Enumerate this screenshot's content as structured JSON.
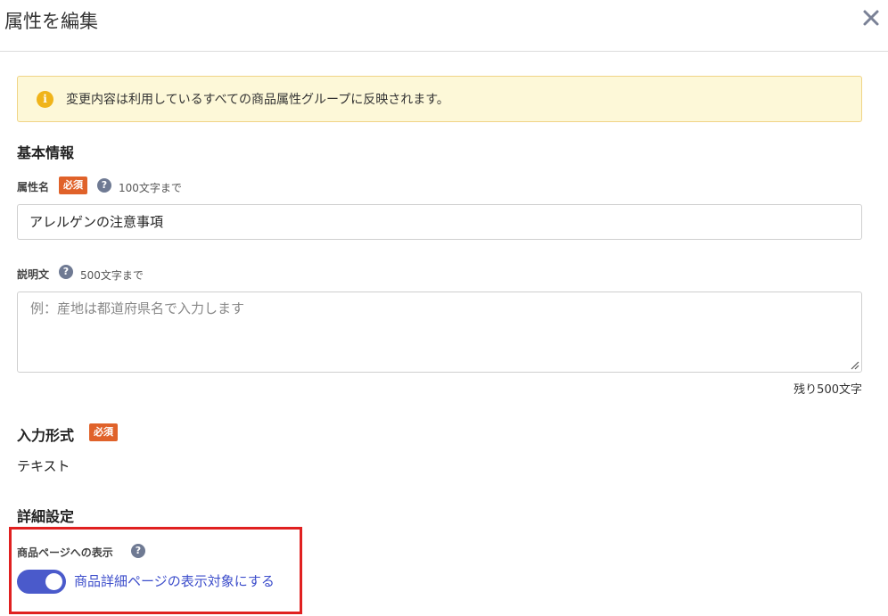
{
  "dialog": {
    "title": "属性を編集",
    "close_icon": "close-icon"
  },
  "notice": {
    "icon": "info-icon",
    "icon_glyph": "i",
    "text": "変更内容は利用しているすべての商品属性グループに反映されます。",
    "colors": {
      "background": "#fdf8d8",
      "border": "#f0d486",
      "icon": "#f0b41a"
    }
  },
  "basic_info": {
    "section_title": "基本情報",
    "attribute_name": {
      "label": "属性名",
      "required_badge": "必須",
      "help_glyph": "?",
      "hint": "100文字まで",
      "value": "アレルゲンの注意事項"
    },
    "description": {
      "label": "説明文",
      "help_glyph": "?",
      "hint": "500文字まで",
      "placeholder": "例：産地は都道府県名で入力します",
      "value": "",
      "remaining": "残り500文字"
    }
  },
  "input_format": {
    "section_title": "入力形式",
    "required_badge": "必須",
    "value": "テキスト"
  },
  "detail_settings": {
    "section_title": "詳細設定",
    "product_page_display": {
      "label": "商品ページへの表示",
      "help_glyph": "?",
      "toggle_on": true,
      "toggle_label": "商品詳細ページの表示対象にする"
    }
  },
  "colors": {
    "badge": "#e0622a",
    "toggle": "#4a5acb",
    "highlight": "#e02020"
  }
}
